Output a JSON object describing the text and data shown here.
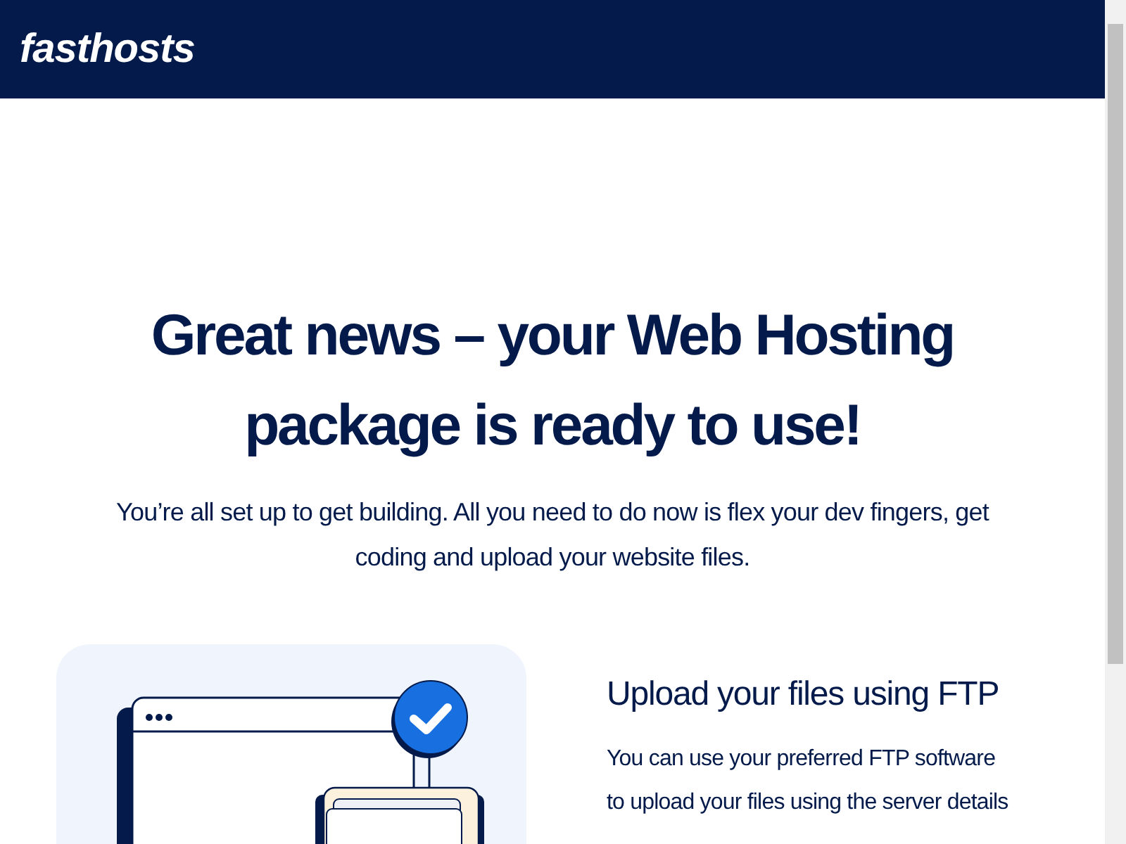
{
  "header": {
    "logo": "fasthosts"
  },
  "hero": {
    "title": "Great news – your Web Hosting package is ready to use!",
    "subtitle": "You’re all set up to get building. All you need to do now is flex your dev fingers, get coding and upload your website files."
  },
  "section": {
    "title": "Upload your files using FTP",
    "body": "You can use your preferred FTP software to upload your files using the server details"
  }
}
